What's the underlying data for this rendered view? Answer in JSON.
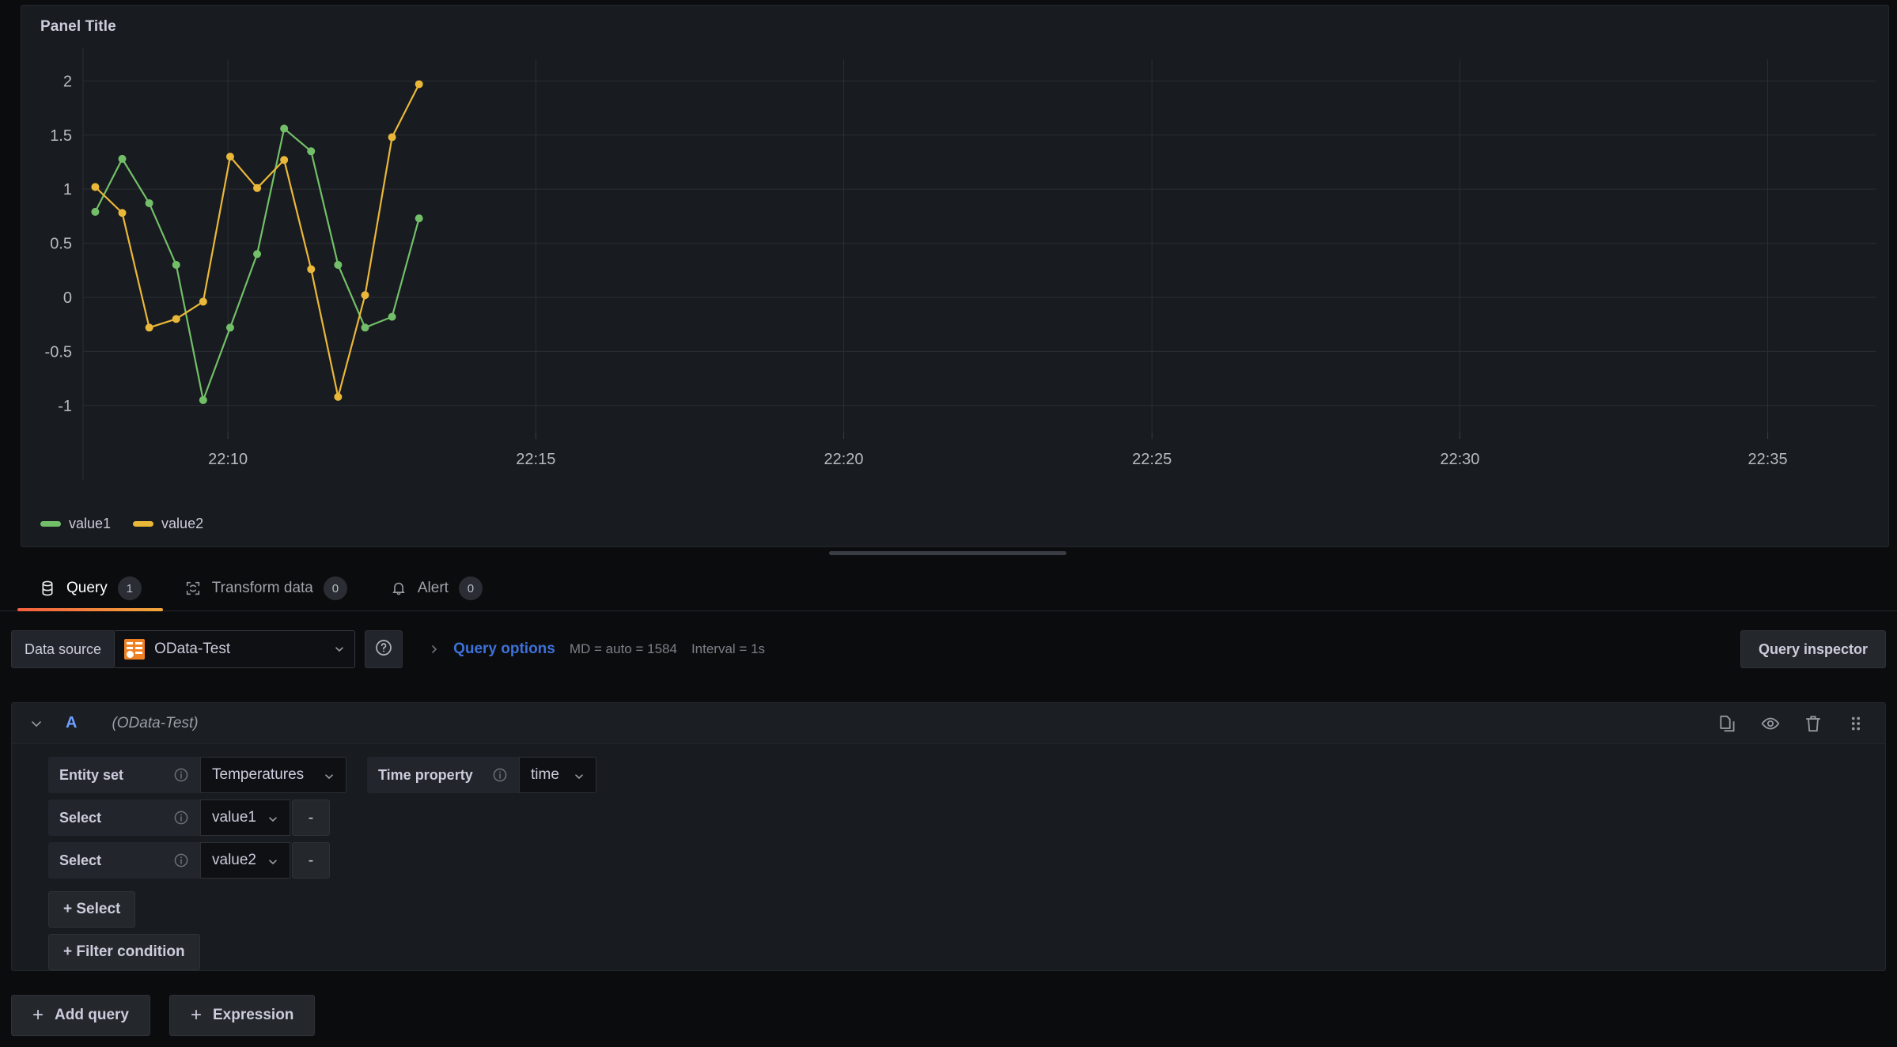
{
  "panel": {
    "title": "Panel Title",
    "legend": [
      {
        "label": "value1",
        "color": "#73bf69"
      },
      {
        "label": "value2",
        "color": "#eab839"
      }
    ]
  },
  "chart_data": {
    "type": "line",
    "title": "Panel Title",
    "xlabel": "",
    "ylabel": "",
    "ylim": [
      -1.25,
      2.2
    ],
    "yticks": [
      "-1",
      "-0.5",
      "0",
      "0.5",
      "1",
      "1.5",
      "2"
    ],
    "ytick_values": [
      -1,
      -0.5,
      0,
      0.5,
      1,
      1.5,
      2
    ],
    "xticks": [
      "22:10",
      "22:15",
      "22:20",
      "22:25",
      "22:30",
      "22:35"
    ],
    "xtick_positions": [
      22.1667,
      22.25,
      22.3333,
      22.4167,
      22.5,
      22.5833
    ],
    "xlim": [
      22.1275,
      22.6125
    ],
    "grid": true,
    "legend_position": "bottom-left",
    "markers": true,
    "x": [
      22.1308,
      22.1381,
      22.1454,
      22.1527,
      22.16,
      22.1673,
      22.1746,
      22.1819,
      22.1892,
      22.1965,
      22.2038,
      22.2111,
      22.2184
    ],
    "series": [
      {
        "name": "value1",
        "color": "#73bf69",
        "values": [
          0.79,
          1.28,
          0.87,
          0.3,
          -0.95,
          -0.28,
          0.4,
          1.56,
          1.35,
          0.3,
          -0.28,
          -0.18,
          0.73
        ]
      },
      {
        "name": "value2",
        "color": "#eab839",
        "values": [
          1.02,
          0.78,
          -0.28,
          -0.2,
          -0.04,
          1.3,
          1.01,
          1.27,
          0.26,
          -0.92,
          0.02,
          1.48,
          1.97
        ]
      }
    ]
  },
  "tabs": [
    {
      "id": "query",
      "label": "Query",
      "count": "1",
      "active": true,
      "icon": "database-icon"
    },
    {
      "id": "transform",
      "label": "Transform data",
      "count": "0",
      "active": false,
      "icon": "transform-icon"
    },
    {
      "id": "alert",
      "label": "Alert",
      "count": "0",
      "active": false,
      "icon": "bell-icon"
    }
  ],
  "datasource_row": {
    "label": "Data source",
    "selected": "OData-Test",
    "help_icon": "help-circle-icon",
    "query_options_label": "Query options",
    "max_data_points": "MD = auto = 1584",
    "interval": "Interval = 1s",
    "query_inspector_label": "Query inspector"
  },
  "query": {
    "ref_id": "A",
    "datasource_hint": "(OData-Test)",
    "actions": [
      {
        "name": "duplicate-query-icon"
      },
      {
        "name": "hide-response-icon"
      },
      {
        "name": "remove-query-icon"
      },
      {
        "name": "drag-handle-icon"
      }
    ],
    "entity_set": {
      "label": "Entity set",
      "value": "Temperatures"
    },
    "time_property": {
      "label": "Time property",
      "value": "time"
    },
    "selects": [
      {
        "label": "Select",
        "value": "value1",
        "remove_label": "-"
      },
      {
        "label": "Select",
        "value": "value2",
        "remove_label": "-"
      }
    ],
    "add_select_label": "+ Select",
    "add_filter_label": "+ Filter condition"
  },
  "bottom": {
    "add_query_label": "Add query",
    "expression_label": "Expression",
    "plus": "+"
  },
  "colors": {
    "accent_tab": "#f55f3e",
    "link": "#3d71d9",
    "refid": "#6e9fff",
    "series1": "#73bf69",
    "series2": "#eab839",
    "panel_bg": "#181b1f",
    "page_bg": "#0b0c0e"
  }
}
